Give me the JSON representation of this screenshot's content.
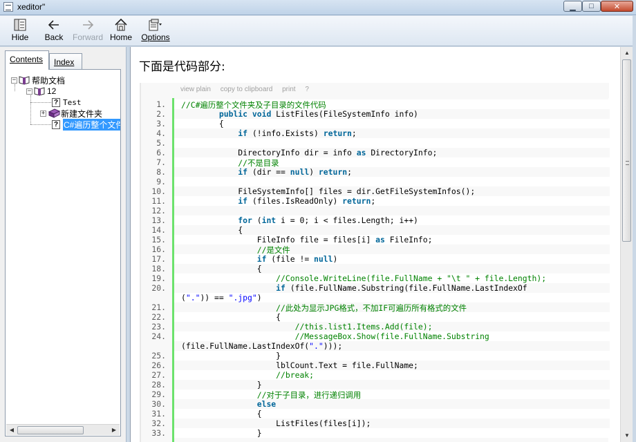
{
  "window": {
    "title": "xeditor\""
  },
  "toolbar": {
    "hide": "Hide",
    "back": "Back",
    "forward": "Forward",
    "home": "Home",
    "options": "Options"
  },
  "tabs": {
    "contents": "Contents",
    "index": "Index"
  },
  "tree": {
    "root": "帮助文档",
    "child_12": "12",
    "test": "Test",
    "new_folder": "新建文件夹",
    "selected": "C#遍历整个文件"
  },
  "content": {
    "heading": "下面是代码部分:",
    "code_toolbar": [
      "view plain",
      "copy to clipboard",
      "print",
      "?"
    ],
    "lines": [
      {
        "n": "1.",
        "t": "//C#遍历整个文件夹及子目录的文件代码"
      },
      {
        "n": "2.",
        "t": "        public void ListFiles(FileSystemInfo info)"
      },
      {
        "n": "3.",
        "t": "        {"
      },
      {
        "n": "4.",
        "t": "            if (!info.Exists) return;"
      },
      {
        "n": "5.",
        "t": ""
      },
      {
        "n": "6.",
        "t": "            DirectoryInfo dir = info as DirectoryInfo;"
      },
      {
        "n": "7.",
        "t": "            //不是目录"
      },
      {
        "n": "8.",
        "t": "            if (dir == null) return;"
      },
      {
        "n": "9.",
        "t": ""
      },
      {
        "n": "10.",
        "t": "            FileSystemInfo[] files = dir.GetFileSystemInfos();"
      },
      {
        "n": "11.",
        "t": "            if (files.IsReadOnly) return;"
      },
      {
        "n": "12.",
        "t": ""
      },
      {
        "n": "13.",
        "t": "            for (int i = 0; i < files.Length; i++)"
      },
      {
        "n": "14.",
        "t": "            {"
      },
      {
        "n": "15.",
        "t": "                FileInfo file = files[i] as FileInfo;"
      },
      {
        "n": "16.",
        "t": "                //是文件"
      },
      {
        "n": "17.",
        "t": "                if (file != null)"
      },
      {
        "n": "18.",
        "t": "                {"
      },
      {
        "n": "19.",
        "t": "                    //Console.WriteLine(file.FullName + \"\\t \" + file.Length);"
      },
      {
        "n": "20.",
        "t": "                    if (file.FullName.Substring(file.FullName.LastIndexOf"
      },
      {
        "n": "",
        "t": "(\".\")) == \".jpg\")"
      },
      {
        "n": "21.",
        "t": "                    //此处为显示JPG格式，不加IF可遍历所有格式的文件"
      },
      {
        "n": "22.",
        "t": "                    {"
      },
      {
        "n": "23.",
        "t": "                        //this.list1.Items.Add(file);"
      },
      {
        "n": "24.",
        "t": "                        //MessageBox.Show(file.FullName.Substring"
      },
      {
        "n": "",
        "t": "(file.FullName.LastIndexOf(\".\")));"
      },
      {
        "n": "25.",
        "t": "                    }"
      },
      {
        "n": "26.",
        "t": "                    lblCount.Text = file.FullName;"
      },
      {
        "n": "27.",
        "t": "                    //break;"
      },
      {
        "n": "28.",
        "t": "                }"
      },
      {
        "n": "29.",
        "t": "                //对于子目录，进行递归调用"
      },
      {
        "n": "30.",
        "t": "                else"
      },
      {
        "n": "31.",
        "t": "                {"
      },
      {
        "n": "32.",
        "t": "                    ListFiles(files[i]);"
      },
      {
        "n": "33.",
        "t": "                }"
      }
    ]
  }
}
